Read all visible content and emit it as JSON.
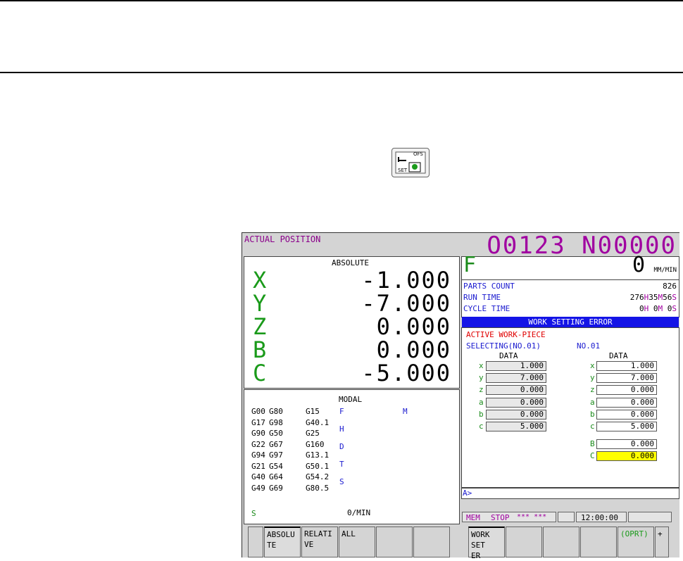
{
  "icon": {
    "labels": {
      "top": "OFS",
      "bottom": "SET"
    }
  },
  "header": {
    "title": "ACTUAL POSITION",
    "program": "O0123 N00000"
  },
  "position": {
    "mode": "ABSOLUTE",
    "axes": [
      {
        "name": "X",
        "value": "-1.000"
      },
      {
        "name": "Y",
        "value": "-7.000"
      },
      {
        "name": "Z",
        "value": "0.000"
      },
      {
        "name": "B",
        "value": "0.000"
      },
      {
        "name": "C",
        "value": "-5.000"
      }
    ]
  },
  "modal": {
    "title": "MODAL",
    "col1": [
      "G00",
      "G17",
      "G90",
      "G22",
      "G94",
      "G21",
      "G40",
      "G49"
    ],
    "col2": [
      "G80",
      "G98",
      "G50",
      "G67",
      "G97",
      "G54",
      "G64",
      "G69"
    ],
    "col3": [
      "G15",
      "G40.1",
      "G25",
      "G160",
      "G13.1",
      "G50.1",
      "G54.2",
      "G80.5"
    ],
    "letters": [
      "F",
      "H",
      "D",
      "T",
      "S"
    ],
    "m_label": "M",
    "spindle_label": "S",
    "feed_rate": "0/MIN"
  },
  "feed": {
    "label": "F",
    "value": "0",
    "unit": "MM/MIN"
  },
  "info": {
    "parts_count_label": "PARTS COUNT",
    "parts_count": "826",
    "run_time_label": "RUN TIME",
    "run_time": {
      "h": "276",
      "h_unit": "H",
      "m": "35",
      "m_unit": "M",
      "s": "56",
      "s_unit": "S"
    },
    "cycle_time_label": "CYCLE TIME",
    "cycle_time": {
      "h": "0",
      "h_unit": "H",
      "m": "0",
      "m_unit": "M",
      "s": "0",
      "s_unit": "S"
    }
  },
  "work_setting": {
    "title": "WORK SETTING ERROR",
    "active_label": "ACTIVE WORK-PIECE",
    "selecting_label": "SELECTING(NO.01)",
    "no_label": "NO.01",
    "data_header": "DATA",
    "left": [
      {
        "name": "x",
        "value": "1.000"
      },
      {
        "name": "y",
        "value": "7.000"
      },
      {
        "name": "z",
        "value": "0.000"
      },
      {
        "name": "a",
        "value": "0.000"
      },
      {
        "name": "b",
        "value": "0.000"
      },
      {
        "name": "c",
        "value": "5.000"
      }
    ],
    "right": [
      {
        "name": "x",
        "value": "1.000"
      },
      {
        "name": "y",
        "value": "7.000"
      },
      {
        "name": "z",
        "value": "0.000"
      },
      {
        "name": "a",
        "value": "0.000"
      },
      {
        "name": "b",
        "value": "0.000"
      },
      {
        "name": "c",
        "value": "5.000"
      }
    ],
    "extra": [
      {
        "name": "B",
        "value": "0.000"
      },
      {
        "name": "C",
        "value": "0.000"
      }
    ]
  },
  "input": {
    "prompt": "A>"
  },
  "status": {
    "mode": "MEM",
    "state": "STOP",
    "stars": "*** ***",
    "time": "12:00:00"
  },
  "softkeys": {
    "left": [
      "",
      "ABSOLU TE",
      "RELATI VE",
      "ALL",
      "",
      ""
    ],
    "right": [
      "WORK SET ER",
      "",
      "",
      "",
      "(OPRT)",
      "+"
    ]
  },
  "colors": {
    "background": "#d4d4d4",
    "title_bar": "#1414e6",
    "highlight": "#ffff00",
    "axis_green": "#1a9a1a",
    "program_magenta": "#a000a0"
  }
}
